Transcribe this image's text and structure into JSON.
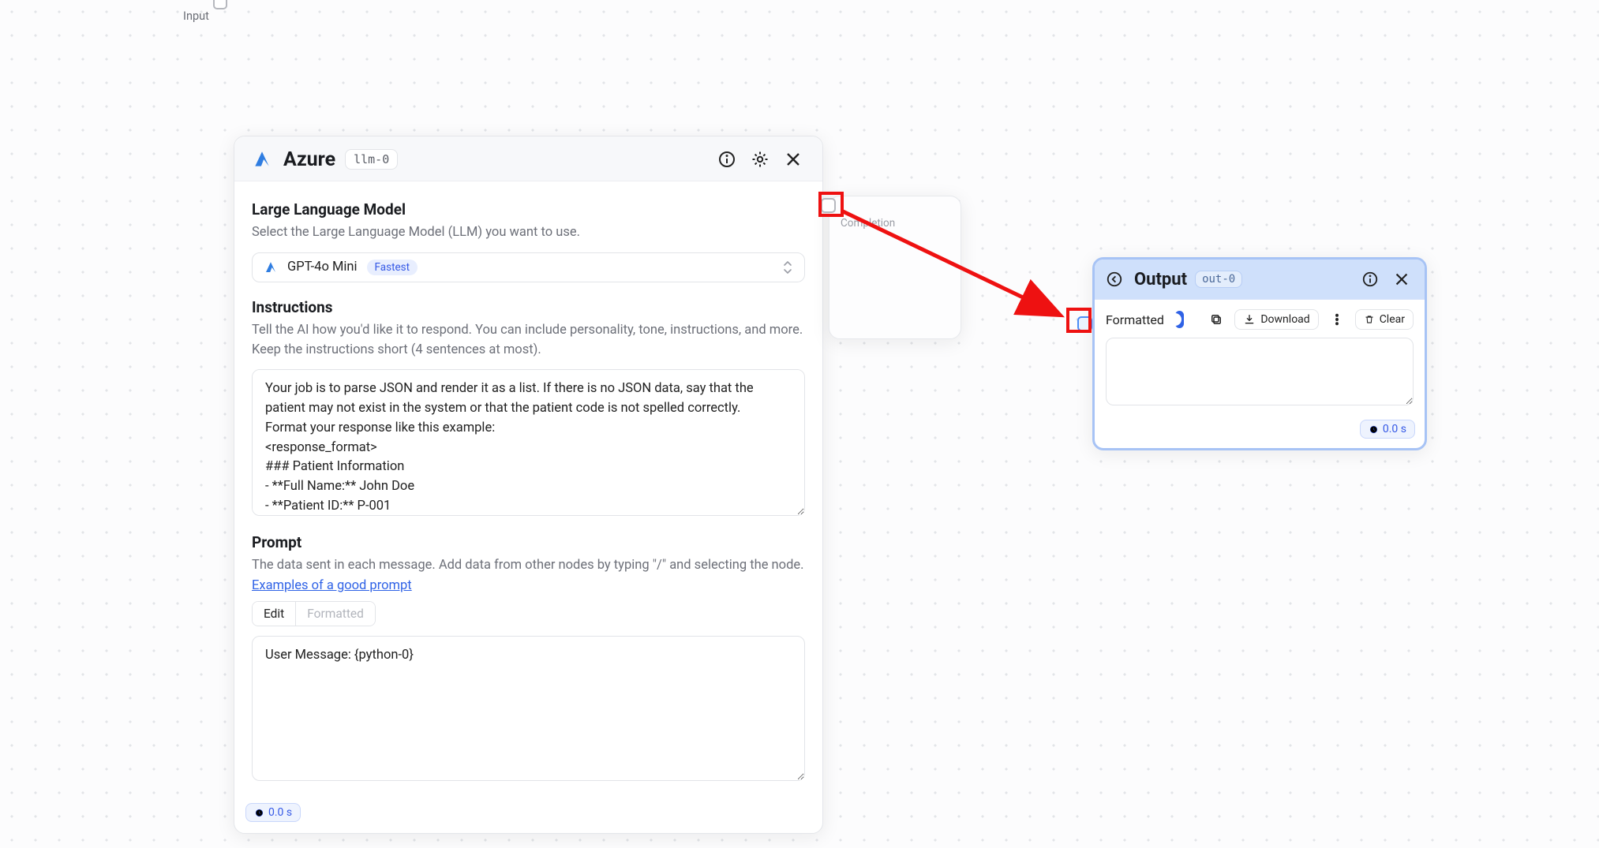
{
  "input_node": {
    "label": "Input"
  },
  "azure": {
    "title": "Azure",
    "tag": "llm-0",
    "llm_section_title": "Large Language Model",
    "llm_section_desc": "Select the Large Language Model (LLM) you want to use.",
    "model_name": "GPT-4o Mini",
    "model_badge": "Fastest",
    "instructions_title": "Instructions",
    "instructions_desc": "Tell the AI how you'd like it to respond. You can include personality, tone, instructions, and more. Keep the instructions short (4 sentences at most).",
    "instructions_value": "Your job is to parse JSON and render it as a list. If there is no JSON data, say that the patient may not exist in the system or that the patient code is not spelled correctly.\nFormat your response like this example:\n<response_format>\n### Patient Information\n- **Full Name:** John Doe\n- **Patient ID:** P-001",
    "prompt_title": "Prompt",
    "prompt_desc": "The data sent in each message. Add data from other nodes by typing \"/\" and selecting the node.",
    "prompt_link": "Examples of a good prompt",
    "tab_edit": "Edit",
    "tab_formatted": "Formatted",
    "prompt_value": "User Message: {python-0}",
    "time": "0.0 s"
  },
  "completion": {
    "label": "Completion"
  },
  "output": {
    "title": "Output",
    "tag": "out-0",
    "formatted_label": "Formatted",
    "download_label": "Download",
    "clear_label": "Clear",
    "time": "0.0 s"
  }
}
